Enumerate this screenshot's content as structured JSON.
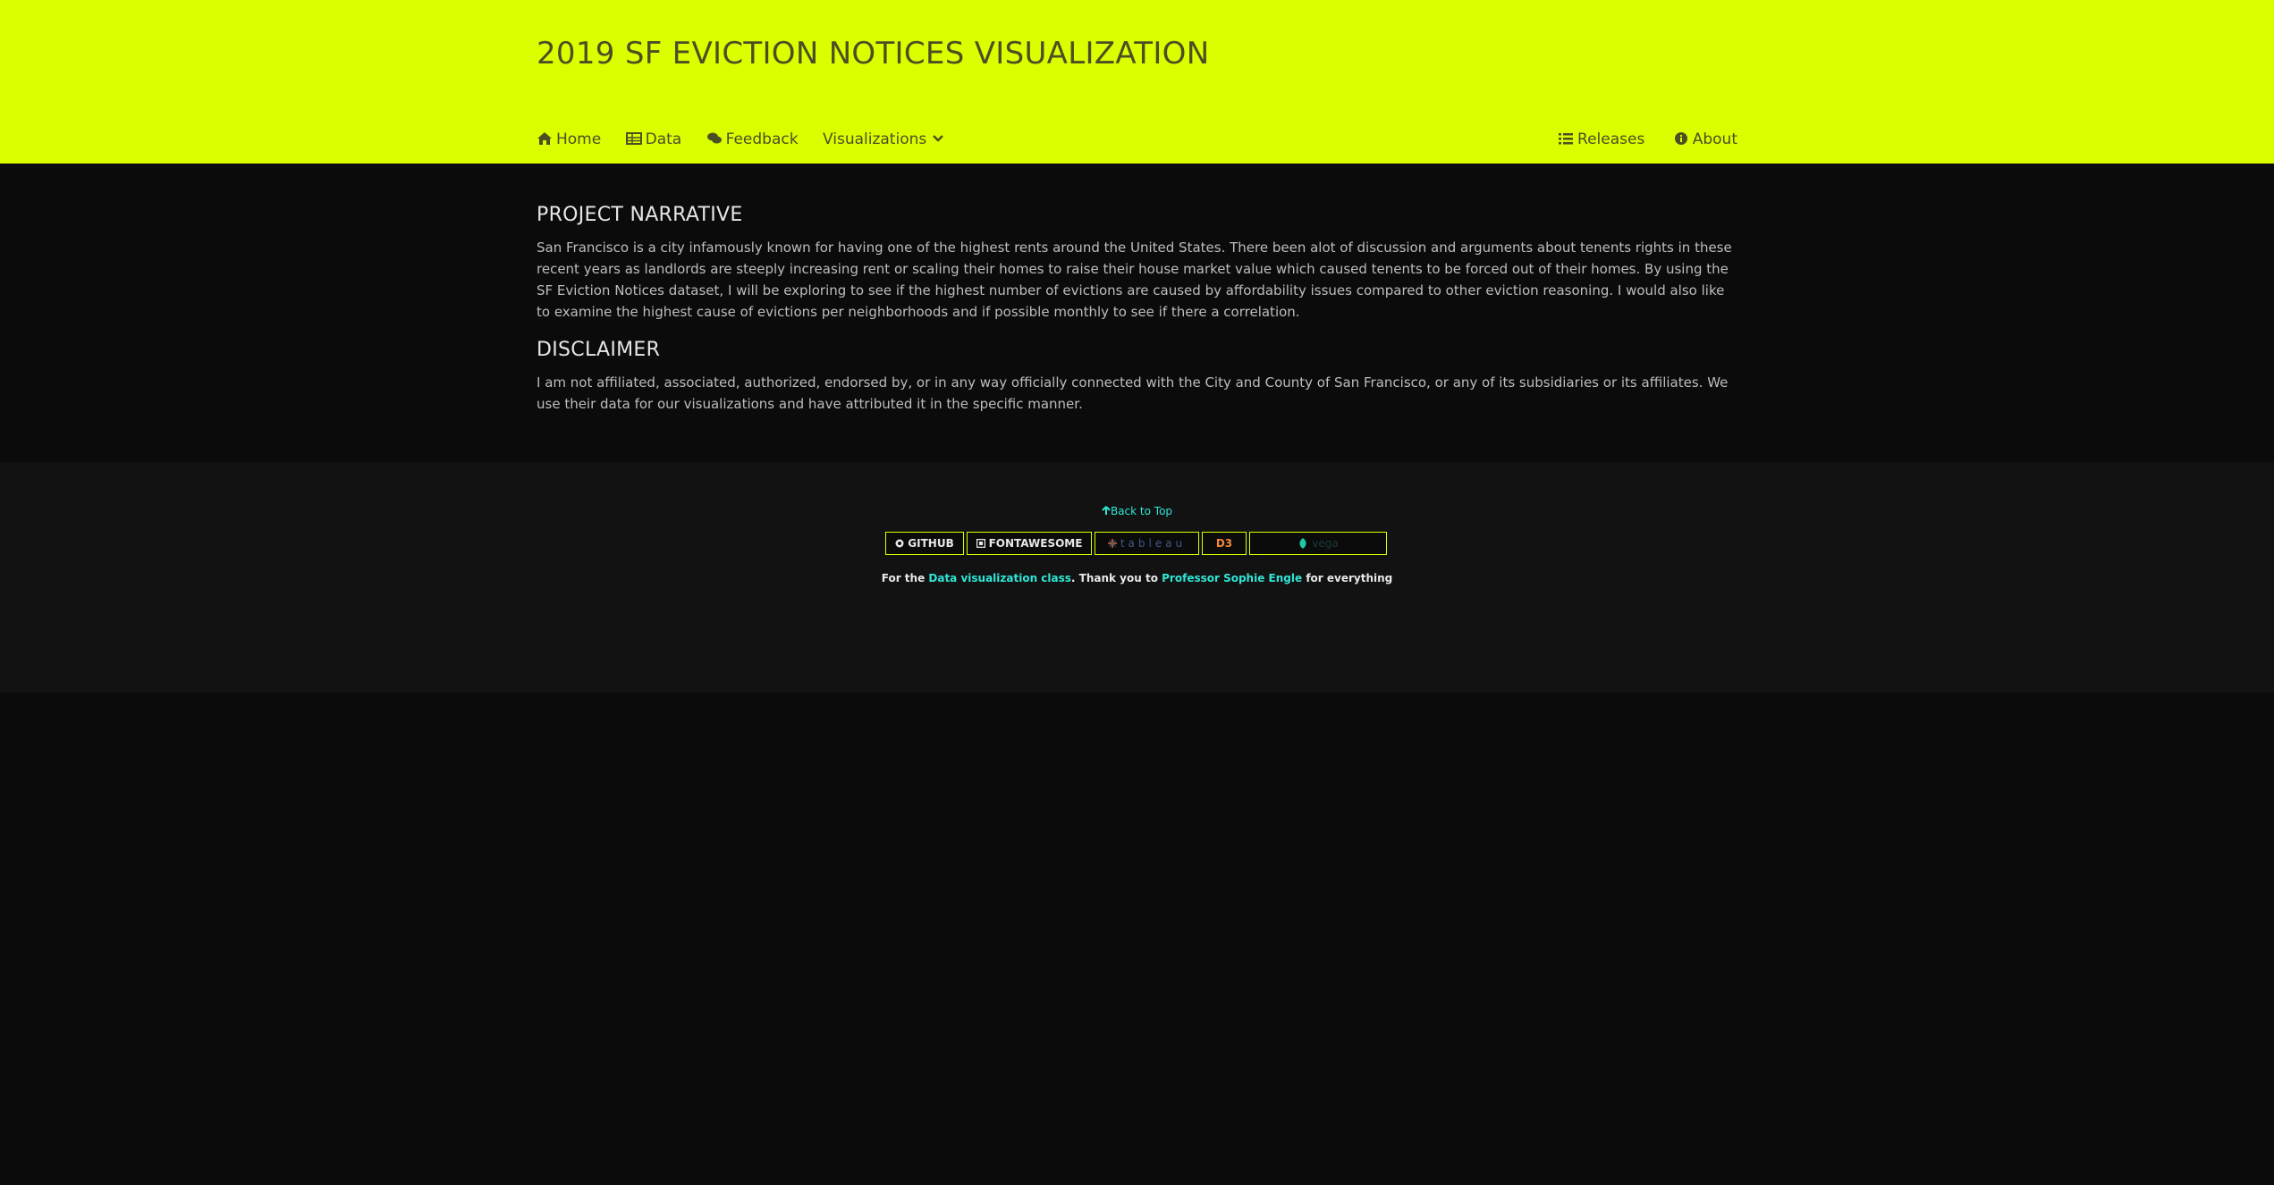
{
  "header": {
    "title": "2019 SF EVICTION NOTICES VISUALIZATION",
    "nav_left": [
      {
        "label": "Home",
        "icon": "home-icon"
      },
      {
        "label": "Data",
        "icon": "table-icon"
      },
      {
        "label": "Feedback",
        "icon": "comments-icon"
      },
      {
        "label": "Visualizations",
        "icon": "chevron-down-icon"
      }
    ],
    "nav_right": [
      {
        "label": "Releases",
        "icon": "list-icon"
      },
      {
        "label": "About",
        "icon": "info-circle-icon"
      }
    ]
  },
  "main": {
    "narrative_title": "PROJECT NARRATIVE",
    "narrative_text": "San Francisco is a city infamously known for having one of the highest rents around the United States. There been alot of discussion and arguments about tenents rights in these recent years as landlords are steeply increasing rent or scaling their homes to raise their house market value which caused tenents to be forced out of their homes. By using the SF Eviction Notices dataset, I will be exploring to see if the highest number of evictions are caused by affordability issues compared to other eviction reasoning. I would also like to examine the highest cause of evictions per neighborhoods and if possible monthly to see if there a correlation.",
    "disclaimer_title": "DISCLAIMER",
    "disclaimer_text": "I am not affiliated, associated, authorized, endorsed by, or in any way officially connected with the City and County of San Francisco, or any of its subsidiaries or its affiliates. We use their data for our visualizations and have attributed it in the specific manner."
  },
  "footer": {
    "back_to_top": "Back to Top",
    "badges": {
      "github": "GITHUB",
      "fontawesome": "FONTAWESOME",
      "tableau": "tableau",
      "d3": "D3",
      "vega": "vega"
    },
    "credit_prefix": "For the",
    "credit_link1": "Data visualization class",
    "credit_mid": ". Thank you to",
    "credit_link2": "Professor Sophie Engle",
    "credit_suffix": "for everything"
  },
  "colors": {
    "accent": "#dcff00",
    "link": "#2ee6d6",
    "background": "#0b0b0b",
    "footer_background": "#121212"
  }
}
